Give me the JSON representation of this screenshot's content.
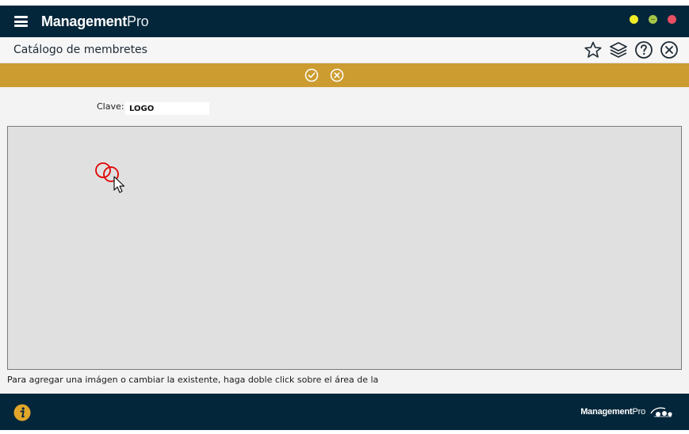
{
  "app": {
    "brand_bold": "Management",
    "brand_light": "Pro"
  },
  "header": {
    "title": "Catálogo de membretes",
    "icons": [
      "star-icon",
      "layers-icon",
      "help-icon",
      "close-circle-icon"
    ]
  },
  "action_bar": {
    "icons": [
      "check-circle-icon",
      "cancel-circle-icon"
    ]
  },
  "form": {
    "clave_label": "Clave:",
    "clave_value": "LOGO"
  },
  "hint": {
    "text": "Para agregar una imágen o cambiar la existente, haga doble click sobre el área de la"
  },
  "footer": {
    "brand_bold": "Management",
    "brand_light": "Pro"
  },
  "colors": {
    "titlebar": "#04263a",
    "accent": "#cc9c30",
    "image_area": "#e0e0e0"
  }
}
